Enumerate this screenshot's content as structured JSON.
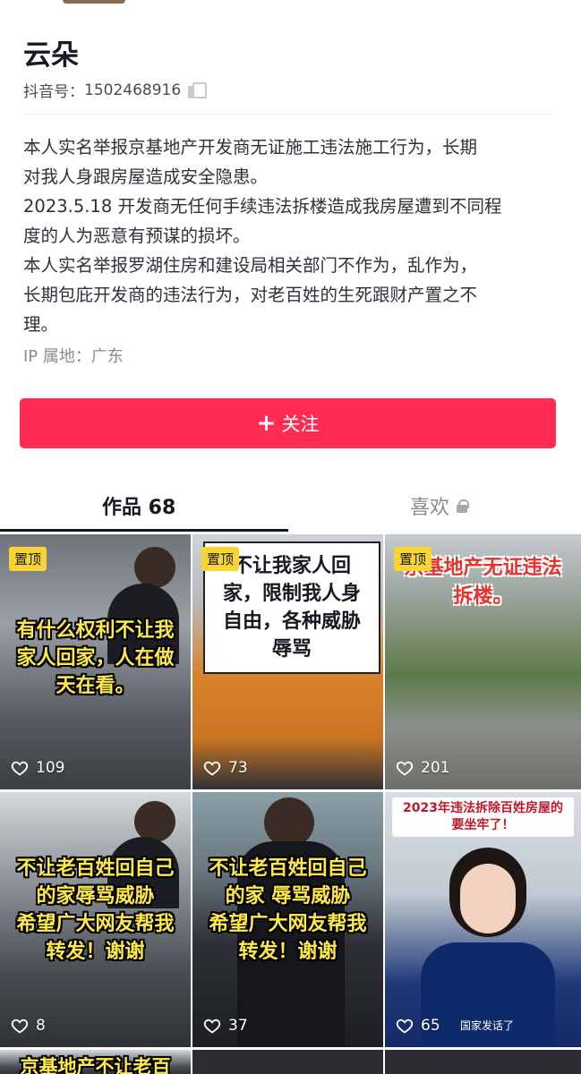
{
  "profile": {
    "name": "云朵",
    "douyin_id_label": "抖音号：",
    "douyin_id": "1502468916",
    "bio_lines": [
      "本人实名举报京基地产开发商无证施工违法施工行为，长期",
      "对我人身跟房屋造成安全隐患。",
      "2023.5.18 开发商无任何手续违法拆楼造成我房屋遭到不同程",
      "度的人为恶意有预谋的损坏。",
      "本人实名举报罗湖住房和建设局相关部门不作为，乱作为，",
      "长期包庇开发商的违法行为，对老百姓的生死跟财产置之不",
      "理。"
    ],
    "ip_location": "IP 属地：广东"
  },
  "follow_button": {
    "icon": "+",
    "label": "关注"
  },
  "tabs": {
    "works": "作品 68",
    "likes": "喜欢"
  },
  "videos": [
    {
      "pinned": "置顶",
      "caption_lines": [
        "有什么权利不让我",
        "家人回家，人在做",
        "天在看。"
      ],
      "likes": "109"
    },
    {
      "pinned": "置顶",
      "caption_lines": [
        "不让我家人回",
        "家，限制我人身",
        "自由，各种威胁",
        "辱骂"
      ],
      "likes": "73"
    },
    {
      "pinned": "置顶",
      "caption_lines": [
        "京基地产无证违法",
        "拆楼。"
      ],
      "likes": "201"
    },
    {
      "caption_lines": [
        "不让老百姓回自己",
        "的家辱骂威胁",
        "希望广大网友帮我",
        "转发！谢谢"
      ],
      "likes": "8"
    },
    {
      "caption_lines": [
        "不让老百姓回自己",
        "的家 辱骂威胁",
        "希望广大网友帮我",
        "转发！谢谢"
      ],
      "likes": "37"
    },
    {
      "banner_lines": [
        "2023年违法拆除百姓房屋的",
        "要坐牢了！"
      ],
      "stamp": "国家发话了",
      "likes": "65"
    },
    {
      "caption_lines": [
        "京基地产不让老百"
      ]
    }
  ],
  "colors": {
    "accent": "#fe2c55",
    "pin_badge": "#f8d531",
    "caption_yellow": "#ffe94a",
    "caption_red": "#e8302c"
  },
  "icons": [
    "copy-icon",
    "plus-icon",
    "lock-icon",
    "heart-icon"
  ]
}
